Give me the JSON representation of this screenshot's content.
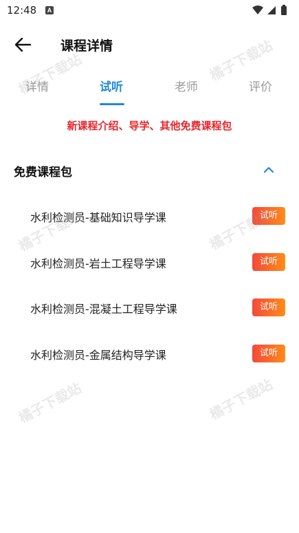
{
  "status_bar": {
    "time": "12:48",
    "notification_icon": "A"
  },
  "header": {
    "title": "课程详情",
    "back_icon": "arrow-left-icon"
  },
  "tabs": [
    {
      "label": "详情",
      "active": false
    },
    {
      "label": "试听",
      "active": true
    },
    {
      "label": "老师",
      "active": false
    },
    {
      "label": "评价",
      "active": false
    }
  ],
  "promo_text": "新课程介绍、导学、其他免费课程包",
  "section": {
    "title": "免费课程包",
    "expanded": true
  },
  "courses": [
    {
      "name": "水利检测员-基础知识导学课",
      "button": "试听"
    },
    {
      "name": "水利检测员-岩土工程导学课",
      "button": "试听"
    },
    {
      "name": "水利检测员-混凝土工程导学课",
      "button": "试听"
    },
    {
      "name": "水利检测员-金属结构导学课",
      "button": "试听"
    }
  ],
  "watermark": "橘子下载站",
  "colors": {
    "accent": "#1f8ad8",
    "promo": "#e8262c",
    "button_start": "#f3493a",
    "button_end": "#ff8c1a"
  }
}
